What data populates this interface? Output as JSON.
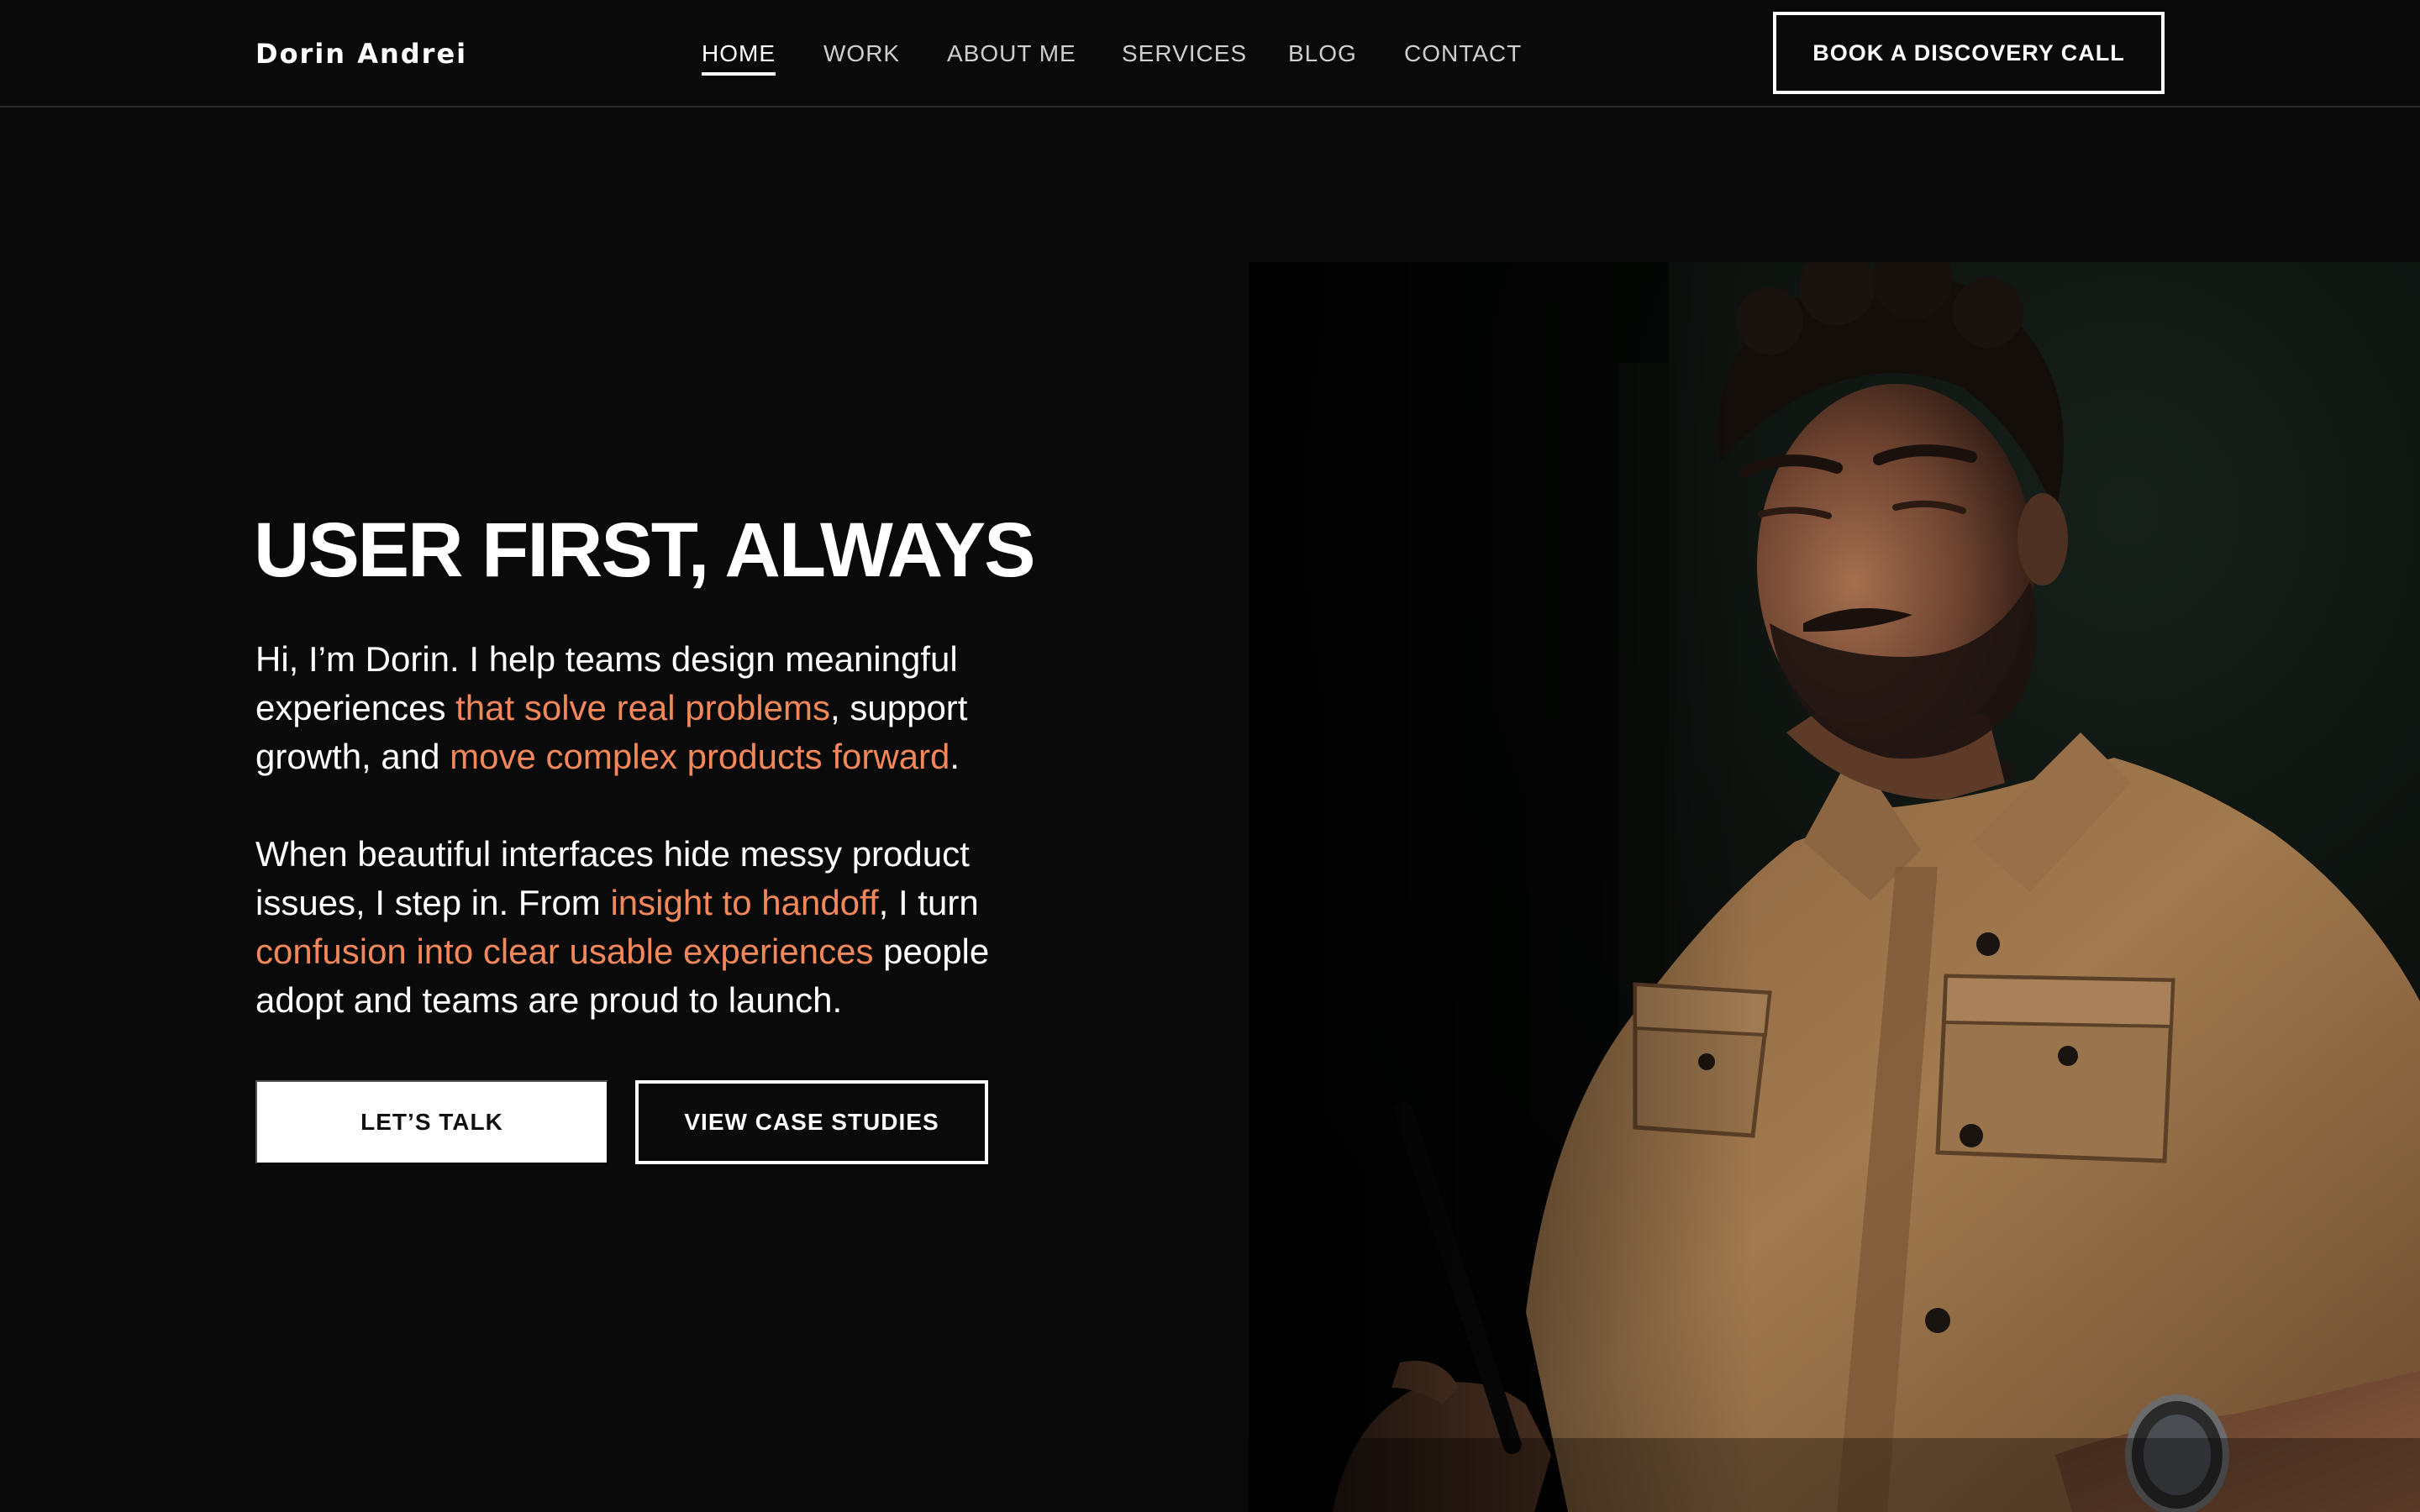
{
  "header": {
    "brand": "Dorin Andrei",
    "nav": [
      {
        "label": "HOME",
        "active": true
      },
      {
        "label": "WORK",
        "active": false
      },
      {
        "label": "ABOUT ME",
        "active": false
      },
      {
        "label": "SERVICES",
        "active": false
      },
      {
        "label": "BLOG",
        "active": false
      },
      {
        "label": "CONTACT",
        "active": false
      }
    ],
    "cta_label": "BOOK A DISCOVERY CALL"
  },
  "hero": {
    "title": "USER FIRST, ALWAYS",
    "p1": {
      "a": "Hi, I’m Dorin. I help teams design meaningful experiences ",
      "b": "that solve real problems",
      "c": ", support growth, and ",
      "d": "move complex products forward",
      "e": "."
    },
    "p2": {
      "a": "When beautiful interfaces hide messy product issues, I step in. From ",
      "b": "insight to handoff",
      "c": ", I turn ",
      "d": "confusion into clear usable experiences",
      "e": " people adopt and teams are proud to launch."
    },
    "primary_button": "LET’S TALK",
    "secondary_button": "VIEW CASE STUDIES"
  },
  "colors": {
    "background": "#0a0a0a",
    "text": "#ffffff",
    "accent": "#f2875a",
    "shirt": "#a27a4f"
  }
}
